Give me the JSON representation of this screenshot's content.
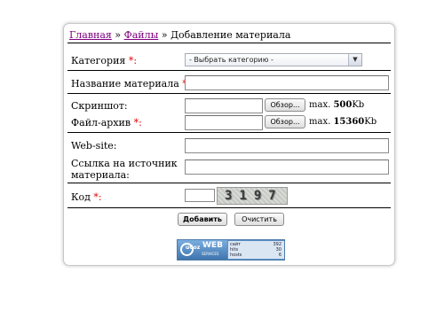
{
  "breadcrumb": {
    "home": "Главная",
    "sep1": "»",
    "files": "Файлы",
    "sep2": "»",
    "current": "Добавление материала"
  },
  "form": {
    "category": {
      "label": "Категория",
      "required": "*:",
      "selected": "- Выбрать категорию -"
    },
    "title": {
      "label": "Название материала",
      "required": "*:"
    },
    "screenshot": {
      "label": "Скриншот:",
      "browse": "Обзор...",
      "limit_prefix": "max.",
      "limit_value": "500",
      "limit_unit": "Kb"
    },
    "archive": {
      "label": "Файл-архив",
      "required": "*:",
      "browse": "Обзор...",
      "limit_prefix": "max.",
      "limit_value": "15360",
      "limit_unit": "Kb"
    },
    "website": {
      "label": "Web-site:"
    },
    "source": {
      "label_line1": "Ссылка на источник",
      "label_line2": "материала:"
    },
    "code": {
      "label": "Код",
      "required": "*:",
      "captcha_text": "3197"
    }
  },
  "buttons": {
    "submit": "Добавить",
    "reset": "Очистить"
  },
  "counter": {
    "brand": "uCoz",
    "web": "WEB",
    "services": "SERVICES",
    "rows": [
      {
        "name": "сайт",
        "value": "392"
      },
      {
        "name": "hits",
        "value": "30"
      },
      {
        "name": "hosts",
        "value": "6"
      }
    ]
  },
  "colors": {
    "link_visited": "#800080",
    "required": "#e00000"
  }
}
